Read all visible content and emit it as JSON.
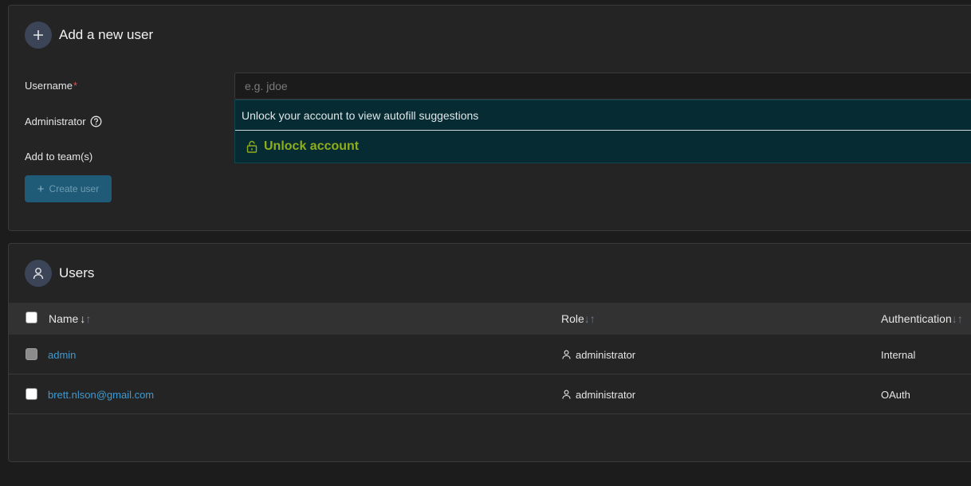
{
  "add_user": {
    "title": "Add a new user",
    "username_label": "Username",
    "required_marker": "*",
    "username_placeholder": "e.g. jdoe",
    "administrator_label": "Administrator",
    "teams_label": "Add to team(s)",
    "create_button_label": "Create user"
  },
  "autofill": {
    "message": "Unlock your account to view autofill suggestions",
    "unlock_label": "Unlock account"
  },
  "users": {
    "title": "Users",
    "columns": {
      "name": "Name",
      "name_sort": "↓",
      "name_sort_alt": "↑",
      "role": "Role",
      "role_sort": "↓↑",
      "auth": "Authentication",
      "auth_sort": "↓↑"
    },
    "rows": [
      {
        "name": "admin",
        "role": "administrator",
        "auth": "Internal"
      },
      {
        "name": "brett.nlson@gmail.com",
        "role": "administrator",
        "auth": "OAuth"
      }
    ]
  },
  "colors": {
    "background": "#1c1c1c",
    "card": "#242424",
    "accent_button": "#1f5a76",
    "link": "#3d9bd4",
    "autofill_bg": "#062b33",
    "unlock_text": "#8fae1b"
  },
  "icons": [
    "plus-icon",
    "help-circle-icon",
    "lock-icon",
    "user-icon",
    "person-icon"
  ]
}
